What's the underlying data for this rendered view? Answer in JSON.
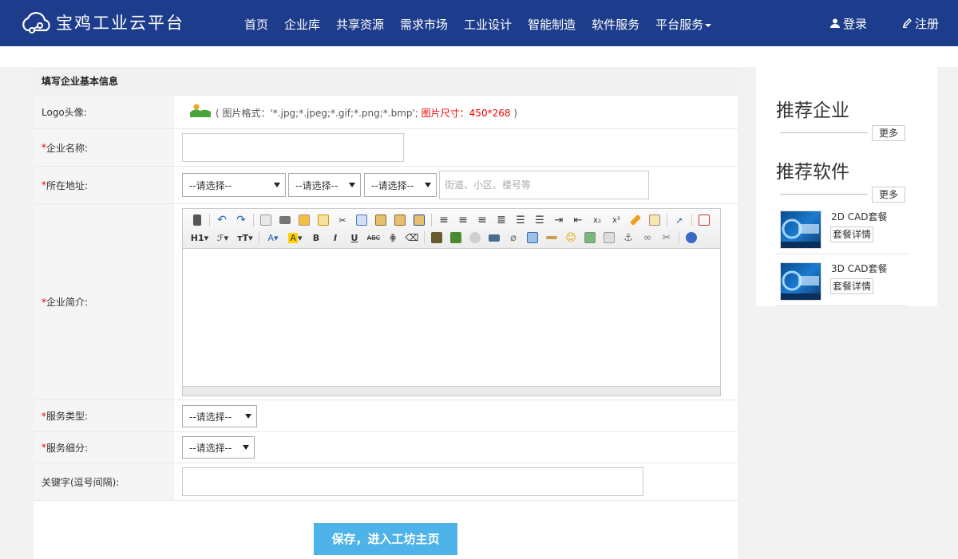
{
  "header": {
    "site_name": "宝鸡工业云平台",
    "nav": [
      "首页",
      "企业库",
      "共享资源",
      "需求市场",
      "工业设计",
      "智能制造",
      "软件服务",
      "平台服务"
    ],
    "login": "登录",
    "register": "注册"
  },
  "form": {
    "section_title": "填写企业基本信息",
    "logo": {
      "label": "Logo头像:",
      "hint": "( 图片格式：'*.jpg;*.jpeg;*.gif;*.png;*.bmp';",
      "hint_size": "图片尺寸：450*268",
      "hint_end": ")"
    },
    "company_name": {
      "label": "企业名称:",
      "value": ""
    },
    "address": {
      "label": "所在地址:",
      "province": "--请选择--",
      "city": "--请选择--",
      "district": "--请选择--",
      "street_placeholder": "街道、小区、楼号等"
    },
    "intro": {
      "label": "企业简介:"
    },
    "service_type": {
      "label": "服务类型:",
      "value": "--请选择--"
    },
    "service_sub": {
      "label": "服务细分:",
      "value": "--请选择--"
    },
    "keywords": {
      "label": "关键字(逗号间隔):",
      "value": ""
    },
    "submit_label": "保存，进入工坊主页"
  },
  "sidebar": {
    "recommend_company": "推荐企业",
    "recommend_software": "推荐软件",
    "more": "更多",
    "software": [
      {
        "name": "2D CAD套餐",
        "button": "套餐详情"
      },
      {
        "name": "3D CAD套餐",
        "button": "套餐详情"
      }
    ]
  },
  "colors": {
    "header_bg": "#1d3c8b",
    "submit_bg": "#4eb3e8",
    "required": "#e00000"
  }
}
